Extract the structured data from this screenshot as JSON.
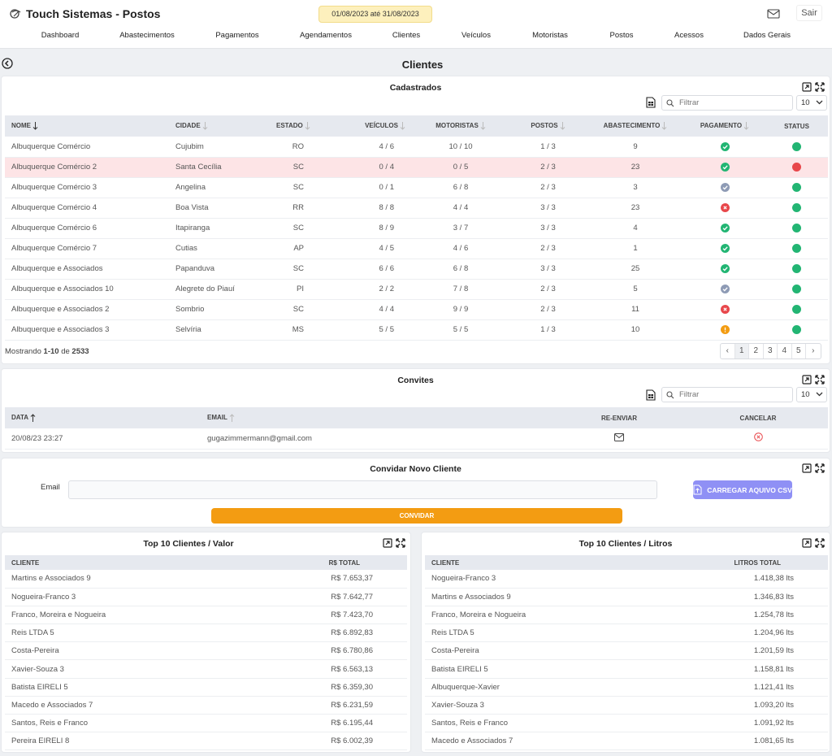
{
  "app": {
    "title": "Touch Sistemas - Postos",
    "date_range": "01/08/2023 até 31/08/2023",
    "logout_label": "Sair"
  },
  "nav": [
    "Dashboard",
    "Abastecimentos",
    "Pagamentos",
    "Agendamentos",
    "Clientes",
    "Veículos",
    "Motoristas",
    "Postos",
    "Acessos",
    "Dados Gerais"
  ],
  "page": {
    "title": "Clientes"
  },
  "registered": {
    "title": "Cadastrados",
    "filter_placeholder": "Filtrar",
    "page_size": "10",
    "columns": [
      "NOME",
      "CIDADE",
      "ESTADO",
      "VEÍCULOS",
      "MOTORISTAS",
      "POSTOS",
      "ABASTECIMENTO",
      "PAGAMENTO",
      "STATUS"
    ],
    "rows": [
      {
        "nome": "Albuquerque Comércio",
        "cidade": "Cujubim",
        "estado": "RO",
        "veiculos": "4 / 6",
        "motoristas": "10 / 10",
        "postos": "1 / 3",
        "abastecimento": "9",
        "pagamento": "ok",
        "status": "active"
      },
      {
        "nome": "Albuquerque Comércio 2",
        "cidade": "Santa Cecília",
        "estado": "SC",
        "veiculos": "0 / 4",
        "motoristas": "0 / 5",
        "postos": "2 / 3",
        "abastecimento": "23",
        "pagamento": "ok",
        "status": "inactive"
      },
      {
        "nome": "Albuquerque Comércio 3",
        "cidade": "Angelina",
        "estado": "SC",
        "veiculos": "0 / 1",
        "motoristas": "6 / 8",
        "postos": "2 / 3",
        "abastecimento": "3",
        "pagamento": "neutral",
        "status": "active"
      },
      {
        "nome": "Albuquerque Comércio 4",
        "cidade": "Boa Vista",
        "estado": "RR",
        "veiculos": "8 / 8",
        "motoristas": "4 / 4",
        "postos": "3 / 3",
        "abastecimento": "23",
        "pagamento": "error",
        "status": "active"
      },
      {
        "nome": "Albuquerque Comércio 6",
        "cidade": "Itapiranga",
        "estado": "SC",
        "veiculos": "8 / 9",
        "motoristas": "3 / 7",
        "postos": "3 / 3",
        "abastecimento": "4",
        "pagamento": "ok",
        "status": "active"
      },
      {
        "nome": "Albuquerque Comércio 7",
        "cidade": "Cutias",
        "estado": "AP",
        "veiculos": "4 / 5",
        "motoristas": "4 / 6",
        "postos": "2 / 3",
        "abastecimento": "1",
        "pagamento": "ok",
        "status": "active"
      },
      {
        "nome": "Albuquerque e Associados",
        "cidade": "Papanduva",
        "estado": "SC",
        "veiculos": "6 / 6",
        "motoristas": "6 / 8",
        "postos": "3 / 3",
        "abastecimento": "25",
        "pagamento": "ok",
        "status": "active"
      },
      {
        "nome": "Albuquerque e Associados 10",
        "cidade": "Alegrete do Piauí",
        "estado": "PI",
        "veiculos": "2 / 2",
        "motoristas": "7 / 8",
        "postos": "2 / 3",
        "abastecimento": "5",
        "pagamento": "neutral",
        "status": "active"
      },
      {
        "nome": "Albuquerque e Associados 2",
        "cidade": "Sombrio",
        "estado": "SC",
        "veiculos": "4 / 4",
        "motoristas": "9 / 9",
        "postos": "2 / 3",
        "abastecimento": "11",
        "pagamento": "error",
        "status": "active"
      },
      {
        "nome": "Albuquerque e Associados 3",
        "cidade": "Selvíria",
        "estado": "MS",
        "veiculos": "5 / 5",
        "motoristas": "5 / 5",
        "postos": "1 / 3",
        "abastecimento": "10",
        "pagamento": "warning",
        "status": "active"
      }
    ],
    "footer": {
      "prefix": "Mostrando",
      "range": "1-10",
      "of": "de",
      "total": "2533"
    },
    "pages": [
      "1",
      "2",
      "3",
      "4",
      "5"
    ]
  },
  "invites": {
    "title": "Convites",
    "filter_placeholder": "Filtrar",
    "page_size": "10",
    "columns": [
      "DATA",
      "EMAIL",
      "RE-ENVIAR",
      "CANCELAR"
    ],
    "rows": [
      {
        "data": "20/08/23 23:27",
        "email": "gugazimmermann@gmail.com"
      }
    ]
  },
  "new_client": {
    "title": "Convidar Novo Cliente",
    "email_label": "Email",
    "csv_button": "CARREGAR AQUIVO CSV",
    "invite_button": "CONVIDAR"
  },
  "top_value": {
    "title": "Top 10 Clientes / Valor",
    "columns": [
      "CLIENTE",
      "R$ TOTAL"
    ],
    "rows": [
      {
        "cliente": "Martins e Associados 9",
        "valor": "R$ 7.653,37"
      },
      {
        "cliente": "Nogueira-Franco 3",
        "valor": "R$ 7.642,77"
      },
      {
        "cliente": "Franco, Moreira e Nogueira",
        "valor": "R$ 7.423,70"
      },
      {
        "cliente": "Reis LTDA 5",
        "valor": "R$ 6.892,83"
      },
      {
        "cliente": "Costa-Pereira",
        "valor": "R$ 6.780,86"
      },
      {
        "cliente": "Xavier-Souza 3",
        "valor": "R$ 6.563,13"
      },
      {
        "cliente": "Batista EIRELI 5",
        "valor": "R$ 6.359,30"
      },
      {
        "cliente": "Macedo e Associados 7",
        "valor": "R$ 6.231,59"
      },
      {
        "cliente": "Santos, Reis e Franco",
        "valor": "R$ 6.195,44"
      },
      {
        "cliente": "Pereira EIRELI 8",
        "valor": "R$ 6.002,39"
      }
    ]
  },
  "top_liters": {
    "title": "Top 10 Clientes / Litros",
    "columns": [
      "CLIENTE",
      "LITROS TOTAL"
    ],
    "rows": [
      {
        "cliente": "Nogueira-Franco 3",
        "litros": "1.418,38 lts"
      },
      {
        "cliente": "Martins e Associados 9",
        "litros": "1.346,83 lts"
      },
      {
        "cliente": "Franco, Moreira e Nogueira",
        "litros": "1.254,78 lts"
      },
      {
        "cliente": "Reis LTDA 5",
        "litros": "1.204,96 lts"
      },
      {
        "cliente": "Costa-Pereira",
        "litros": "1.201,59 lts"
      },
      {
        "cliente": "Batista EIRELI 5",
        "litros": "1.158,81 lts"
      },
      {
        "cliente": "Albuquerque-Xavier",
        "litros": "1.121,41 lts"
      },
      {
        "cliente": "Xavier-Souza 3",
        "litros": "1.093,20 lts"
      },
      {
        "cliente": "Santos, Reis e Franco",
        "litros": "1.091,92 lts"
      },
      {
        "cliente": "Macedo e Associados 7",
        "litros": "1.081,65 lts"
      }
    ]
  },
  "colors": {
    "ok": "#22b573",
    "error": "#e8474b",
    "neutral": "#8e9bb5",
    "warning": "#f39c12",
    "active": "#22b573",
    "inactive": "#e8474b",
    "accent": "#8f90f5",
    "highlight_row": "#fde4e6"
  }
}
